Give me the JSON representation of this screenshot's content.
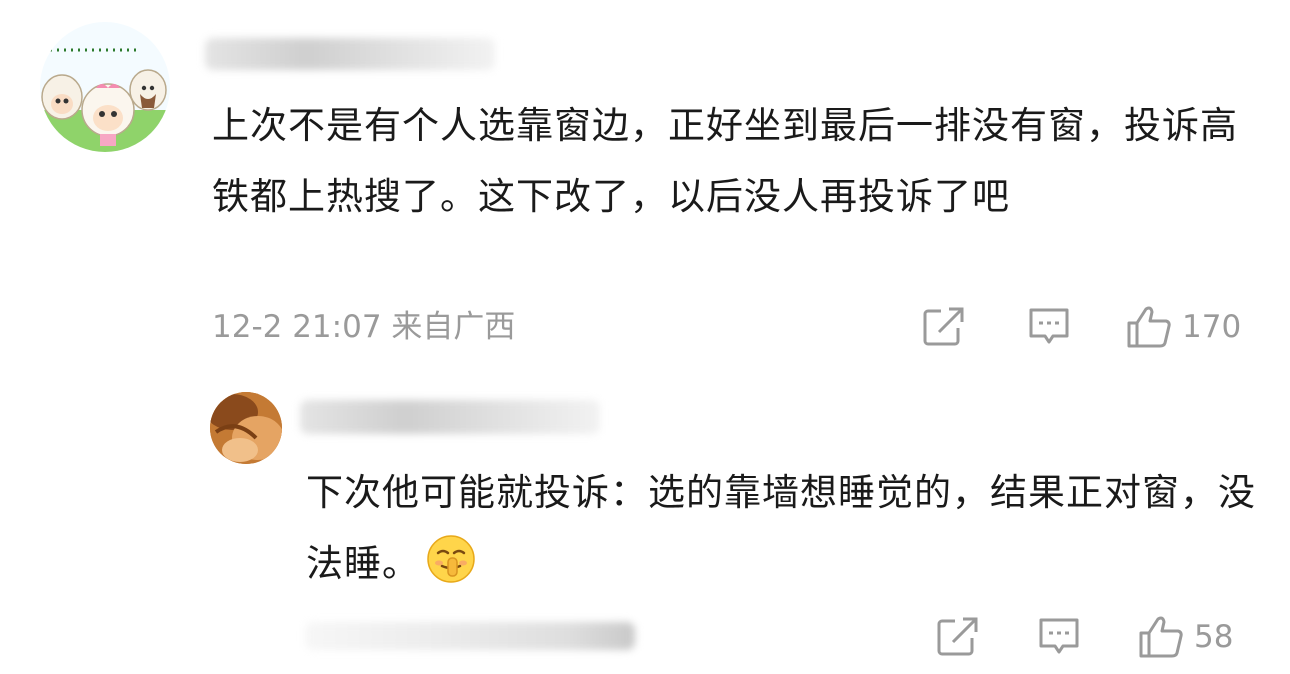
{
  "comment": {
    "text": "上次不是有个人选靠窗边，正好坐到最后一排没有窗，投诉高铁都上热搜了。这下改了，以后没人再投诉了吧",
    "time": "12-2 21:07 来自广西",
    "like_count": "170",
    "avatar_icon": "cartoon-sheep-avatar"
  },
  "reply": {
    "text": "下次他可能就投诉：选的靠墙想睡觉的，结果正对窗，没法睡。",
    "like_count": "58",
    "emoji_icon": "shush-emoji",
    "avatar_icon": "orange-photo-avatar"
  },
  "icons": {
    "share": "share-icon",
    "reply": "comment-icon",
    "like": "thumbs-up-icon"
  },
  "colors": {
    "text": "#1a1a1a",
    "meta": "#9a9a9a",
    "background": "#ffffff"
  }
}
